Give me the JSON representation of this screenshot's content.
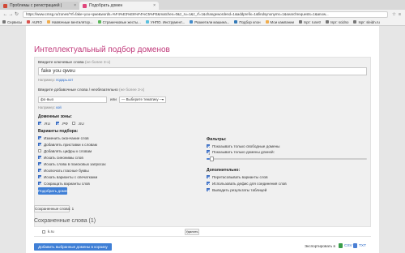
{
  "browser": {
    "tabs": [
      {
        "title": "Проблемы с регистрацией | ",
        "favicon_color": "#d14836"
      },
      {
        "title": "Подобрать домен",
        "favicon_color": "#e0457b"
      }
    ],
    "url": "https://www.cmsg.ru/zones/?rf=fake+you+qwe&words=%F4%E3%E6%F4%C5%FE&matches=0&z_ru=1&z_rf=1&changewordend=1&addprefix=1&findsynonyms=1&searchrequests=1&anow...",
    "bookmarks": [
      {
        "label": "Сервисы",
        "color": "#777777"
      },
      {
        "label": "AURO",
        "color": "#d9534f"
      },
      {
        "label": "Навязчиые вентилятор...",
        "color": "#f0ad4e"
      },
      {
        "label": "Страничковые жесты...",
        "color": "#5cb85c"
      },
      {
        "label": "УНПО. Инструмент...",
        "color": "#5bc0de"
      },
      {
        "label": "Разметили машина...",
        "color": "#428bca"
      },
      {
        "label": "Подбор клон",
        "color": "#337ab7"
      },
      {
        "label": "Мои кампании",
        "color": "#f0ad4e"
      },
      {
        "label": "Ispr: runet!",
        "color": "#777777"
      },
      {
        "label": "Ispr: scidno",
        "color": "#777777"
      },
      {
        "label": "Ispr: sleidn.ru",
        "color": "#777777"
      }
    ]
  },
  "page": {
    "title": "Интеллектуальный подбор доменов",
    "keywords_label": "Введите ключевые слова",
    "keywords_note": " (не более 3-х)",
    "keywords_value": "fake you qweu",
    "keywords_hint_prefix": "Например: ",
    "keywords_hint_link": "подарь.кот",
    "extra_label": "Введите добавочные слова / необязательно",
    "extra_note": " (не более 3-х)",
    "extra_value": "фо·выо",
    "or_word": "или",
    "theme_placeholder": "— Выберите тематику —",
    "extra_hint_prefix": "Например: ",
    "extra_hint_link": "кой",
    "zones_heading": "Доменные зоны:",
    "zones": [
      {
        "label": ".RU",
        "checked": true
      },
      {
        "label": ".РФ",
        "checked": true
      },
      {
        "label": ".SU",
        "checked": false
      }
    ],
    "options_heading": "Варианты подбора:",
    "options": [
      {
        "label": "Изменить окончание слов",
        "checked": true
      },
      {
        "label": "Добавлять приставки к словам",
        "checked": true
      },
      {
        "label": "Добавлять цифры к словам",
        "checked": false
      },
      {
        "label": "Искать синонимы слов",
        "checked": true
      },
      {
        "label": "Искать слова в поисковых запросах",
        "checked": true
      },
      {
        "label": "Исключать гласные буквы",
        "checked": true
      },
      {
        "label": "Искать варианты с опечатками",
        "checked": true
      },
      {
        "label": "Сокращать варианты слов",
        "checked": true
      }
    ],
    "filters_heading": "Фильтры:",
    "filters": [
      {
        "label": "Показывать только свободные домены",
        "checked": true
      },
      {
        "label": "Показывать только домены длиной:",
        "checked": true
      }
    ],
    "slider_value": "1",
    "slider_fraction": 0.02,
    "extra_heading": "Дополнительно:",
    "extras": [
      {
        "label": "Перетасовывать варианты слов",
        "checked": true
      },
      {
        "label": "Использовать дефис для соединения слов",
        "checked": true
      },
      {
        "label": "Выводить результаты таблицей",
        "checked": true
      }
    ],
    "submit_label": "Подобрать домен",
    "saved_button_label": "Сохраненные слова: 1",
    "saved_heading": "Сохраненные слова (1)",
    "saved_words": [
      {
        "label": "k.ru",
        "checked": false
      }
    ],
    "delete_label": "Удалить",
    "add_to_cart_label": "Добавить выбранные домены в корзину",
    "export_label": "Экспортировать в",
    "export_csv": "CSV",
    "export_txt": "TXT"
  }
}
